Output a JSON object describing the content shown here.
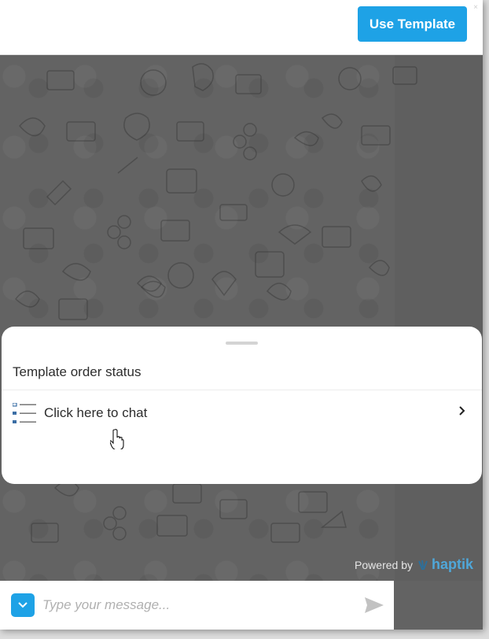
{
  "header": {
    "use_template_label": "Use Template",
    "close_glyph": "×",
    "button_color": "#1ea2e6"
  },
  "chat_background": {
    "color": "#636363",
    "pattern": "doodle-icons"
  },
  "sheet": {
    "title": "Template order status",
    "items": [
      {
        "label": "Click here to chat",
        "icon": "list-icon",
        "trailing_icon": "chevron-right-icon"
      }
    ]
  },
  "footer": {
    "powered_by_label": "Powered by",
    "brand_name": "haptik",
    "brand_icon": "hand-icon",
    "brand_color": "#4fa7d9"
  },
  "composer": {
    "placeholder": "Type your message...",
    "value": "",
    "toggle_icon": "chevron-down-icon",
    "send_icon": "send-icon"
  },
  "cursor": {
    "type": "hand-pointer-icon"
  }
}
